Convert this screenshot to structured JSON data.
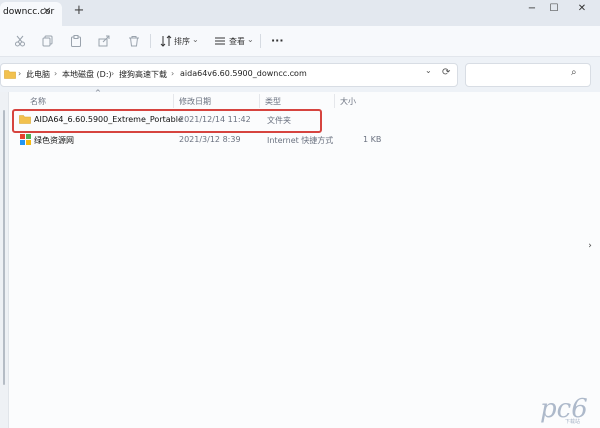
{
  "tab": {
    "title": "downcc.cor",
    "close": "×",
    "new": "+"
  },
  "window": {
    "min": "−",
    "max": "☐",
    "close": "✕"
  },
  "toolbar": {
    "sort_label": "排序",
    "view_label": "查看",
    "more": "···"
  },
  "address": {
    "root": "此电脑",
    "drive": "本地磁盘 (D:)",
    "folder": "搜狗高速下载",
    "current": "aida64v6.60.5900_downcc.com",
    "sep": "›",
    "dropdown": "⌄",
    "refresh": "⟳"
  },
  "search": {
    "icon": "⌕"
  },
  "columns": {
    "name": "名称",
    "date": "修改日期",
    "type": "类型",
    "size": "大小",
    "sort_arrow": "^"
  },
  "rows": [
    {
      "name": "AIDA64_6.60.5900_Extreme_Portable",
      "date": "2021/12/14 11:42",
      "type": "文件夹",
      "size": "",
      "icon": "folder-icon"
    },
    {
      "name": "绿色资源网",
      "date": "2021/3/12 8:39",
      "type": "Internet 快捷方式",
      "size": "1 KB",
      "icon": "internet-shortcut-icon"
    }
  ],
  "watermark": {
    "text": "pc6",
    "sub": "下载站"
  },
  "colors": {
    "highlight": "#d6443f",
    "folder": "#f2c14e",
    "accent": "#0067c0"
  }
}
